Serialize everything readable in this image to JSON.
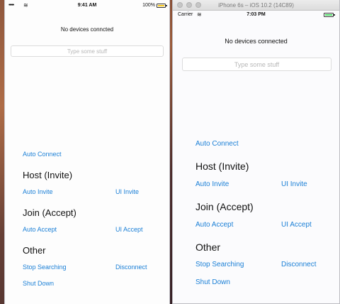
{
  "left_device": {
    "status_bar": {
      "signal": "•••••",
      "wifi": "≋",
      "time": "9:41 AM",
      "battery_pct": "100%",
      "battery_color": "#f5c518"
    },
    "status_label": "No devices conncted",
    "text_input_placeholder": "Type some stuff",
    "auto_connect_label": "Auto Connect",
    "host_section": {
      "heading": "Host (Invite)",
      "auto_label": "Auto Invite",
      "ui_label": "UI Invite"
    },
    "join_section": {
      "heading": "Join (Accept)",
      "auto_label": "Auto Accept",
      "ui_label": "UI Accept"
    },
    "other_section": {
      "heading": "Other",
      "stop_label": "Stop Searching",
      "disconnect_label": "Disconnect",
      "shutdown_label": "Shut Down"
    }
  },
  "simulator_window": {
    "title": "iPhone 6s – iOS 10.2 (14C89)",
    "status_bar": {
      "carrier": "Carrier",
      "wifi": "≋",
      "time": "7:03 PM",
      "battery_color": "#4cd964"
    },
    "status_label": "No devices connected",
    "text_input_placeholder": "Type some stuff",
    "auto_connect_label": "Auto Connect",
    "host_section": {
      "heading": "Host (Invite)",
      "auto_label": "Auto Invite",
      "ui_label": "UI Invite"
    },
    "join_section": {
      "heading": "Join (Accept)",
      "auto_label": "Auto Accept",
      "ui_label": "UI Accept"
    },
    "other_section": {
      "heading": "Other",
      "stop_label": "Stop Searching",
      "disconnect_label": "Disconnect",
      "shutdown_label": "Shut Down"
    }
  },
  "colors": {
    "link": "#1a7fd6",
    "heading": "#111111",
    "placeholder": "#b7b7b7"
  }
}
